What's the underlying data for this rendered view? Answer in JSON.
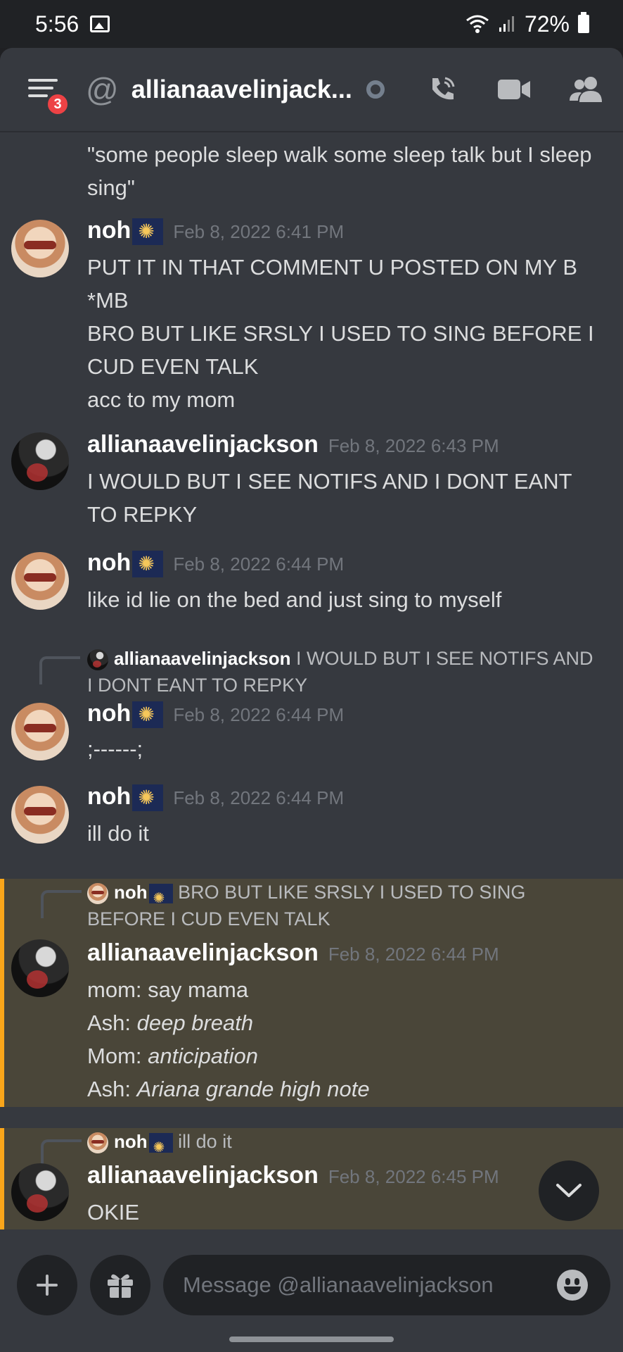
{
  "status_bar": {
    "time": "5:56",
    "battery": "72%"
  },
  "header": {
    "badge_count": "3",
    "dm_name": "allianaavelinjack..."
  },
  "messages": [
    {
      "text": "\"some people sleep walk some sleep talk but I sleep sing\""
    },
    {
      "author": "noh",
      "timestamp": "Feb 8, 2022 6:41 PM",
      "lines": [
        "PUT IT IN THAT COMMENT U POSTED ON MY B",
        "*MB",
        "BRO BUT LIKE SRSLY I USED TO SING BEFORE I CUD EVEN TALK",
        "acc to my mom"
      ]
    },
    {
      "author": "allianaavelinjackson",
      "timestamp": "Feb 8, 2022 6:43 PM",
      "lines": [
        "I WOULD BUT I SEE NOTIFS AND I DONT EANT TO REPKY"
      ]
    },
    {
      "author": "noh",
      "timestamp": "Feb 8, 2022 6:44 PM",
      "lines": [
        "like id lie on the bed and just sing to myself"
      ]
    },
    {
      "reply_author": "allianaavelinjackson",
      "reply_text": "I WOULD BUT I SEE NOTIFS AND I DONT EANT TO REPKY",
      "author": "noh",
      "timestamp": "Feb 8, 2022 6:44 PM",
      "lines": [
        ";------;"
      ]
    },
    {
      "author": "noh",
      "timestamp": "Feb 8, 2022 6:44 PM",
      "lines": [
        "ill do it"
      ]
    },
    {
      "reply_author": "noh",
      "reply_text": "BRO BUT LIKE SRSLY I USED TO SING BEFORE I CUD EVEN TALK",
      "author": "allianaavelinjackson",
      "timestamp": "Feb 8, 2022 6:44 PM",
      "lines": [
        {
          "prefix": "mom: say mama",
          "italic": ""
        },
        {
          "prefix": "Ash: ",
          "italic": "deep breath"
        },
        {
          "prefix": "Mom: ",
          "italic": "anticipation"
        },
        {
          "prefix": "Ash: ",
          "italic": "Ariana grande high note"
        }
      ]
    },
    {
      "reply_author": "noh",
      "reply_text": "ill do it",
      "author": "allianaavelinjackson",
      "timestamp": "Feb 8, 2022 6:45 PM",
      "lines": [
        "OKIE"
      ]
    }
  ],
  "composer": {
    "placeholder": "Message @allianaavelinjackson"
  },
  "colors": {
    "background": "#36393f",
    "highlight": "#4a4639",
    "highlight_border": "#faa61a",
    "badge": "#ed4245"
  },
  "icons": [
    "menu-icon",
    "at-icon",
    "status-idle-icon",
    "call-icon",
    "video-icon",
    "members-icon",
    "chevron-down-icon",
    "plus-icon",
    "gift-icon",
    "emoji-icon"
  ]
}
